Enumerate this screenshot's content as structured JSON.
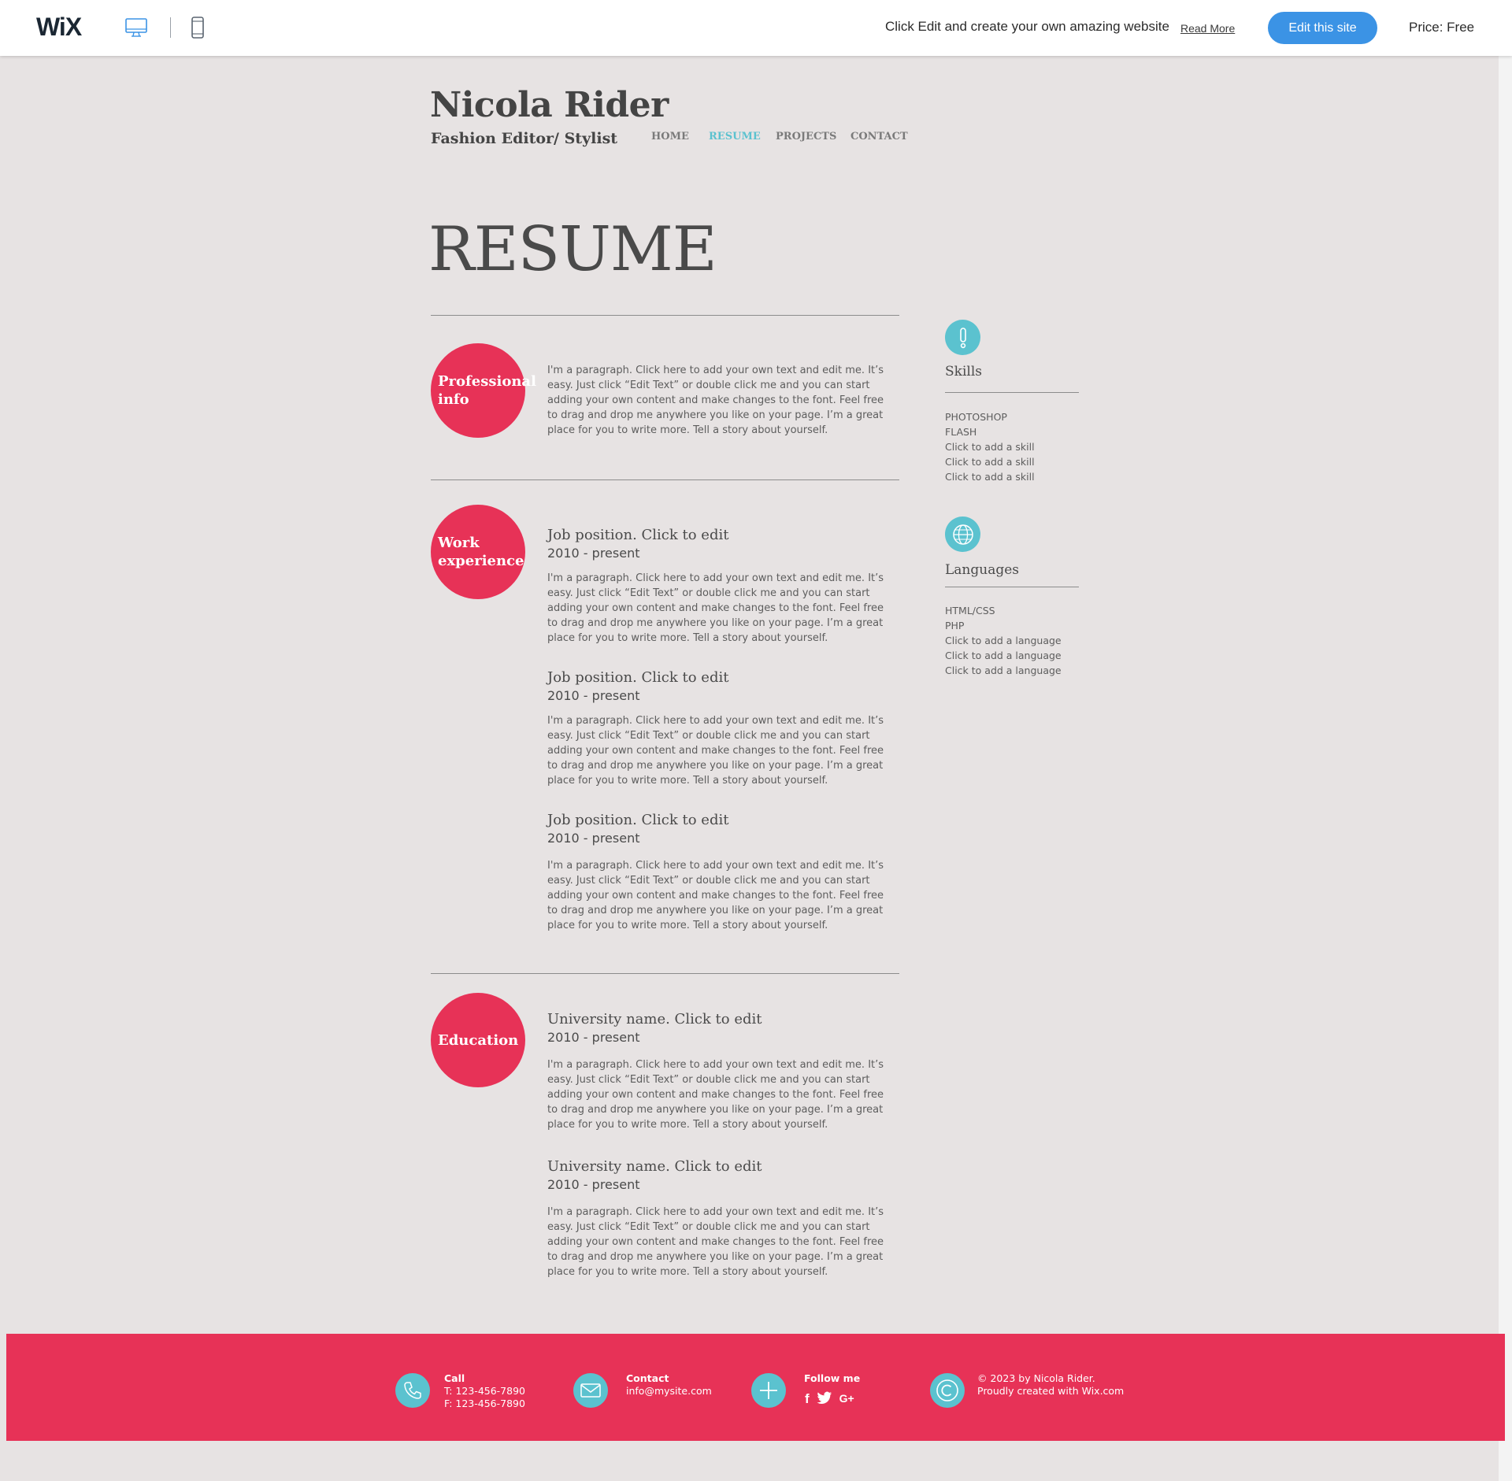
{
  "wix_bar": {
    "logo": "WiX",
    "promo_text": "Click Edit and create your own amazing website",
    "read_more": "Read More",
    "edit_button": "Edit this site",
    "price": "Price: Free",
    "brand_color": "#3b93e5"
  },
  "site": {
    "name": "Nicola Rider",
    "tagline": "Fashion Editor/ Stylist",
    "nav": [
      "HOME",
      "RESUME",
      "PROJECTS",
      "CONTACT"
    ],
    "active_nav": "RESUME",
    "page_title": "RESUME",
    "accent_color": "#e73257",
    "secondary_color": "#5bc2cf"
  },
  "sections": {
    "professional": {
      "label": "Professional info",
      "paragraph": "I'm a paragraph. Click here to add your own text and edit me. It’s easy. Just click “Edit Text” or double click me and you can start adding your own content and make changes to the font. Feel free to drag and drop me anywhere you like on your page. I’m a great place for you to write more. Tell a story about yourself."
    },
    "work": {
      "label": "Work experience",
      "entries": [
        {
          "title": "Job position. Click to edit",
          "date": "2010 - present",
          "text": "I'm a paragraph. Click here to add your own text and edit me. It’s easy. Just click “Edit Text” or double click me and you can start adding your own content and make changes to the font. Feel free to drag and drop me anywhere you like on your page. I’m a great place for you to write more. Tell a story about yourself."
        },
        {
          "title": "Job position. Click to edit",
          "date": "2010 - present",
          "text": "I'm a paragraph. Click here to add your own text and edit me. It’s easy. Just click “Edit Text” or double click me and you can start adding your own content and make changes to the font. Feel free to drag and drop me anywhere you like on your page. I’m a great place for you to write more. Tell a story about yourself."
        },
        {
          "title": "Job position. Click to edit",
          "date": "2010 - present",
          "text": "I'm a paragraph. Click here to add your own text and edit me. It’s easy. Just click “Edit Text” or double click me and you can start adding your own content and make changes to the font. Feel free to drag and drop me anywhere you like on your page. I’m a great place for you to write more. Tell a story about yourself."
        }
      ]
    },
    "education": {
      "label": "Education",
      "entries": [
        {
          "title": "University name. Click to edit",
          "date": "2010 - present",
          "text": "I'm a paragraph. Click here to add your own text and edit me. It’s easy. Just click “Edit Text” or double click me and you can start adding your own content and make changes to the font. Feel free to drag and drop me anywhere you like on your page. I’m a great place for you to write more. Tell a story about yourself."
        },
        {
          "title": "University name. Click to edit",
          "date": "2010 - present",
          "text": "I'm a paragraph. Click here to add your own text and edit me. It’s easy. Just click “Edit Text” or double click me and you can start adding your own content and make changes to the font. Feel free to drag and drop me anywhere you like on your page. I’m a great place for you to write more. Tell a story about yourself."
        }
      ]
    }
  },
  "sidebar": {
    "skills": {
      "heading": "Skills",
      "icon": "exclamation-icon",
      "items": [
        "PHOTOSHOP",
        "FLASH",
        "Click to add a skill",
        "Click to add a skill",
        "Click to add a skill"
      ]
    },
    "languages": {
      "heading": "Languages",
      "icon": "globe-icon",
      "items": [
        "HTML/CSS",
        "PHP",
        "Click to add a language",
        "Click to add a language",
        "Click to add a language"
      ]
    }
  },
  "footer": {
    "call": {
      "label": "Call",
      "phone": "T: 123-456-7890",
      "fax": "F: 123-456-7890"
    },
    "contact": {
      "label": "Contact",
      "email": "info@mysite.com"
    },
    "follow": {
      "label": "Follow me",
      "networks": [
        "f",
        "t",
        "G+"
      ]
    },
    "copyright": {
      "line1": "© 2023 by Nicola Rider.",
      "line2": "Proudly created with Wix.com"
    }
  }
}
